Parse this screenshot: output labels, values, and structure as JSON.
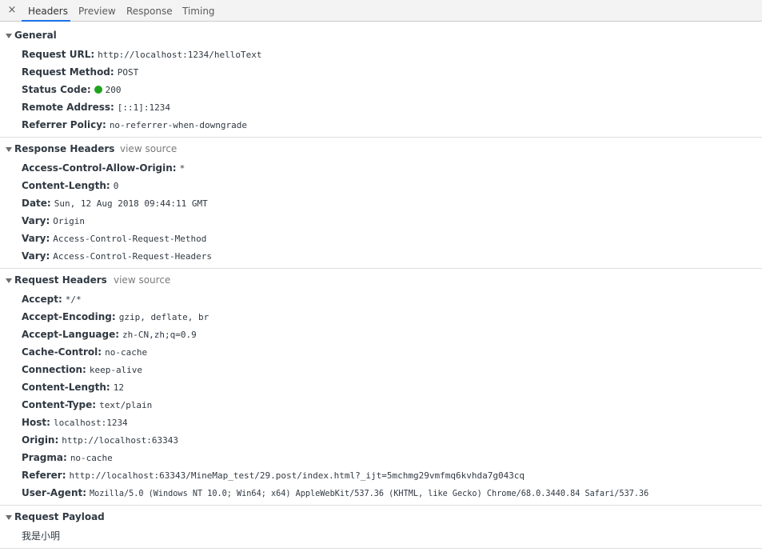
{
  "tabs": {
    "close": "×",
    "items": [
      "Headers",
      "Preview",
      "Response",
      "Timing"
    ],
    "active": "Headers"
  },
  "general": {
    "title": "General",
    "rows": [
      {
        "key": "Request URL:",
        "value": "http://localhost:1234/helloText"
      },
      {
        "key": "Request Method:",
        "value": "POST"
      },
      {
        "key": "Status Code:",
        "value": "200",
        "status_color": "#1fa31f"
      },
      {
        "key": "Remote Address:",
        "value": "[::1]:1234"
      },
      {
        "key": "Referrer Policy:",
        "value": "no-referrer-when-downgrade"
      }
    ]
  },
  "response_headers": {
    "title": "Response Headers",
    "view_source": "view source",
    "rows": [
      {
        "key": "Access-Control-Allow-Origin:",
        "value": "*"
      },
      {
        "key": "Content-Length:",
        "value": "0"
      },
      {
        "key": "Date:",
        "value": "Sun, 12 Aug 2018 09:44:11 GMT"
      },
      {
        "key": "Vary:",
        "value": "Origin"
      },
      {
        "key": "Vary:",
        "value": "Access-Control-Request-Method"
      },
      {
        "key": "Vary:",
        "value": "Access-Control-Request-Headers"
      }
    ]
  },
  "request_headers": {
    "title": "Request Headers",
    "view_source": "view source",
    "rows": [
      {
        "key": "Accept:",
        "value": "*/*"
      },
      {
        "key": "Accept-Encoding:",
        "value": "gzip, deflate, br"
      },
      {
        "key": "Accept-Language:",
        "value": "zh-CN,zh;q=0.9"
      },
      {
        "key": "Cache-Control:",
        "value": "no-cache"
      },
      {
        "key": "Connection:",
        "value": "keep-alive"
      },
      {
        "key": "Content-Length:",
        "value": "12"
      },
      {
        "key": "Content-Type:",
        "value": "text/plain"
      },
      {
        "key": "Host:",
        "value": "localhost:1234"
      },
      {
        "key": "Origin:",
        "value": "http://localhost:63343"
      },
      {
        "key": "Pragma:",
        "value": "no-cache"
      },
      {
        "key": "Referer:",
        "value": "http://localhost:63343/MineMap_test/29.post/index.html?_ijt=5mchmg29vmfmq6kvhda7g043cq"
      },
      {
        "key": "User-Agent:",
        "value": "Mozilla/5.0 (Windows NT 10.0; Win64; x64) AppleWebKit/537.36 (KHTML, like Gecko) Chrome/68.0.3440.84 Safari/537.36"
      }
    ]
  },
  "request_payload": {
    "title": "Request Payload",
    "body": "我是小明"
  }
}
